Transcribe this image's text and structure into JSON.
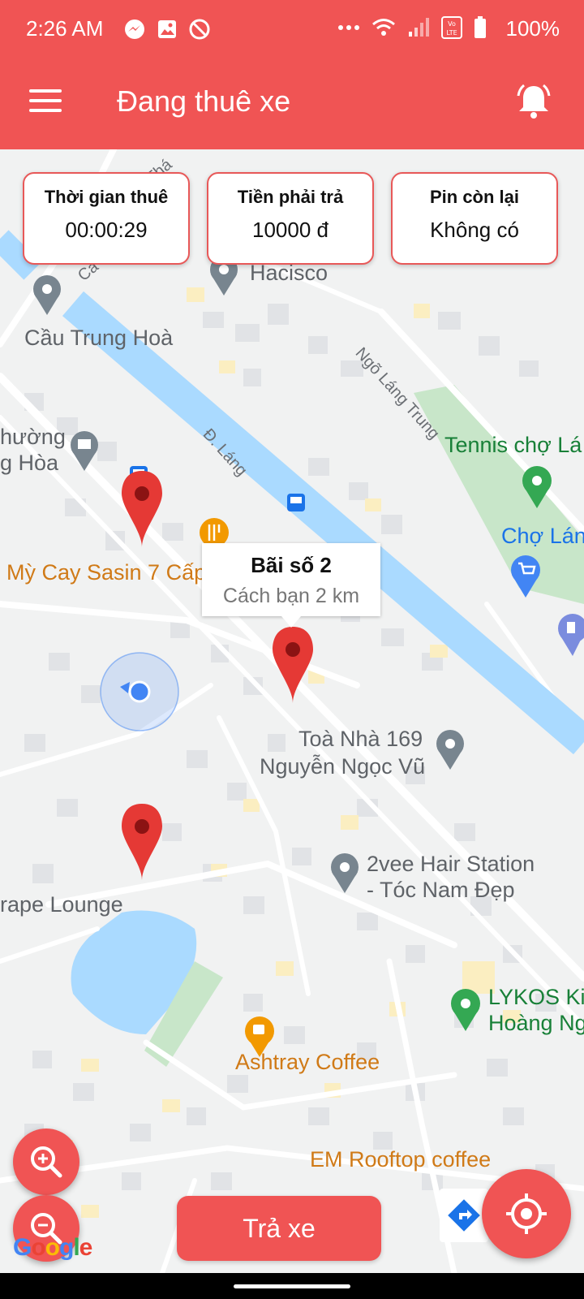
{
  "status_bar": {
    "time": "2:26 AM",
    "battery": "100%",
    "icons_left": [
      "messenger-icon",
      "image-icon",
      "block-icon"
    ],
    "icons_right": [
      "more-dots-icon",
      "wifi-icon",
      "signal-icon",
      "volte-icon",
      "battery-icon"
    ]
  },
  "app_bar": {
    "title": "Đang thuê xe",
    "menu_icon": "menu-icon",
    "bell_icon": "bell-icon"
  },
  "cards": [
    {
      "title": "Thời gian thuê",
      "value": "00:00:29"
    },
    {
      "title": "Tiền phải trả",
      "value": "10000 đ"
    },
    {
      "title": "Pin còn lại",
      "value": "Không có"
    }
  ],
  "callout": {
    "title": "Bãi số 2",
    "subtitle": "Cách bạn 2 km"
  },
  "map": {
    "pois": [
      "Hacisco",
      "Cầu Trung Hoà",
      "hường",
      "g Hòa",
      "Tennis chợ Lá",
      "Chợ Lán",
      "Mỳ Cay Sasin 7 Cấp",
      "Toà Nhà 169",
      "Nguyễn Ngọc Vũ",
      "2vee Hair Station",
      "- Tóc Nam Đẹp",
      "rape Lounge",
      "LYKOS Kid",
      "Hoàng Ng",
      "Ashtray Coffee",
      "EM Rooftop coffee"
    ],
    "streets": [
      "Ngõ Láng Trung",
      "Đ. Láng",
      "Thá",
      "Ca"
    ],
    "colors": {
      "water": "#aadaff",
      "park": "#c8e6c9",
      "road": "#ffffff",
      "block": "#e1e3e6",
      "marker": "#e53935",
      "accent": "#f05454"
    }
  },
  "buttons": {
    "zoom_in_icon": "zoom-in-icon",
    "zoom_out_icon": "zoom-out-icon",
    "return_label": "Trả xe",
    "locate_icon": "my-location-icon",
    "directions_icon": "directions-icon"
  },
  "google_logo": "Google"
}
